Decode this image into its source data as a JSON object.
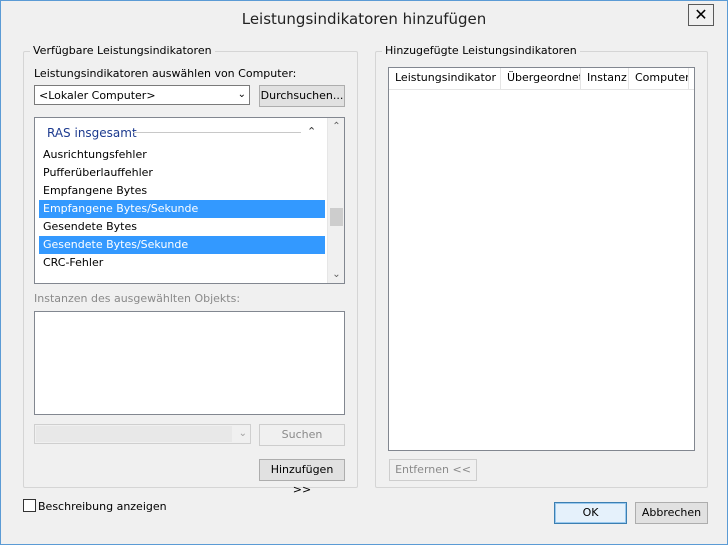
{
  "window": {
    "title": "Leistungsindikatoren hinzufügen",
    "close_symbol": "✕"
  },
  "left_panel": {
    "group_title": "Verfügbare Leistungsindikatoren",
    "computer_label": "Leistungsindikatoren auswählen von Computer:",
    "computer_combo_value": "<Lokaler Computer>",
    "browse_button": "Durchsuchen...",
    "counter_list": {
      "category": "RAS insgesamt",
      "items": [
        {
          "label": "Ausrichtungsfehler",
          "selected": false
        },
        {
          "label": "Pufferüberlauffehler",
          "selected": false
        },
        {
          "label": "Empfangene Bytes",
          "selected": false
        },
        {
          "label": "Empfangene Bytes/Sekunde",
          "selected": true
        },
        {
          "label": "Gesendete Bytes",
          "selected": false
        },
        {
          "label": "Gesendete Bytes/Sekunde",
          "selected": true
        },
        {
          "label": "CRC-Fehler",
          "selected": false
        }
      ]
    },
    "instances_label": "Instanzen des ausgewählten Objekts:",
    "search_button": "Suchen",
    "add_button": "Hinzufügen >>"
  },
  "right_panel": {
    "group_title": "Hinzugefügte Leistungsindikatoren",
    "columns": [
      "Leistungsindikator",
      "Übergeordnet",
      "Instanz",
      "Computer"
    ],
    "remove_button": "Entfernen <<"
  },
  "footer": {
    "show_description_label": "Beschreibung anzeigen",
    "ok_button": "OK",
    "cancel_button": "Abbrechen"
  },
  "colors": {
    "selection": "#3399ff",
    "category_text": "#1c3a8f",
    "window_border": "#5b9bd5"
  }
}
